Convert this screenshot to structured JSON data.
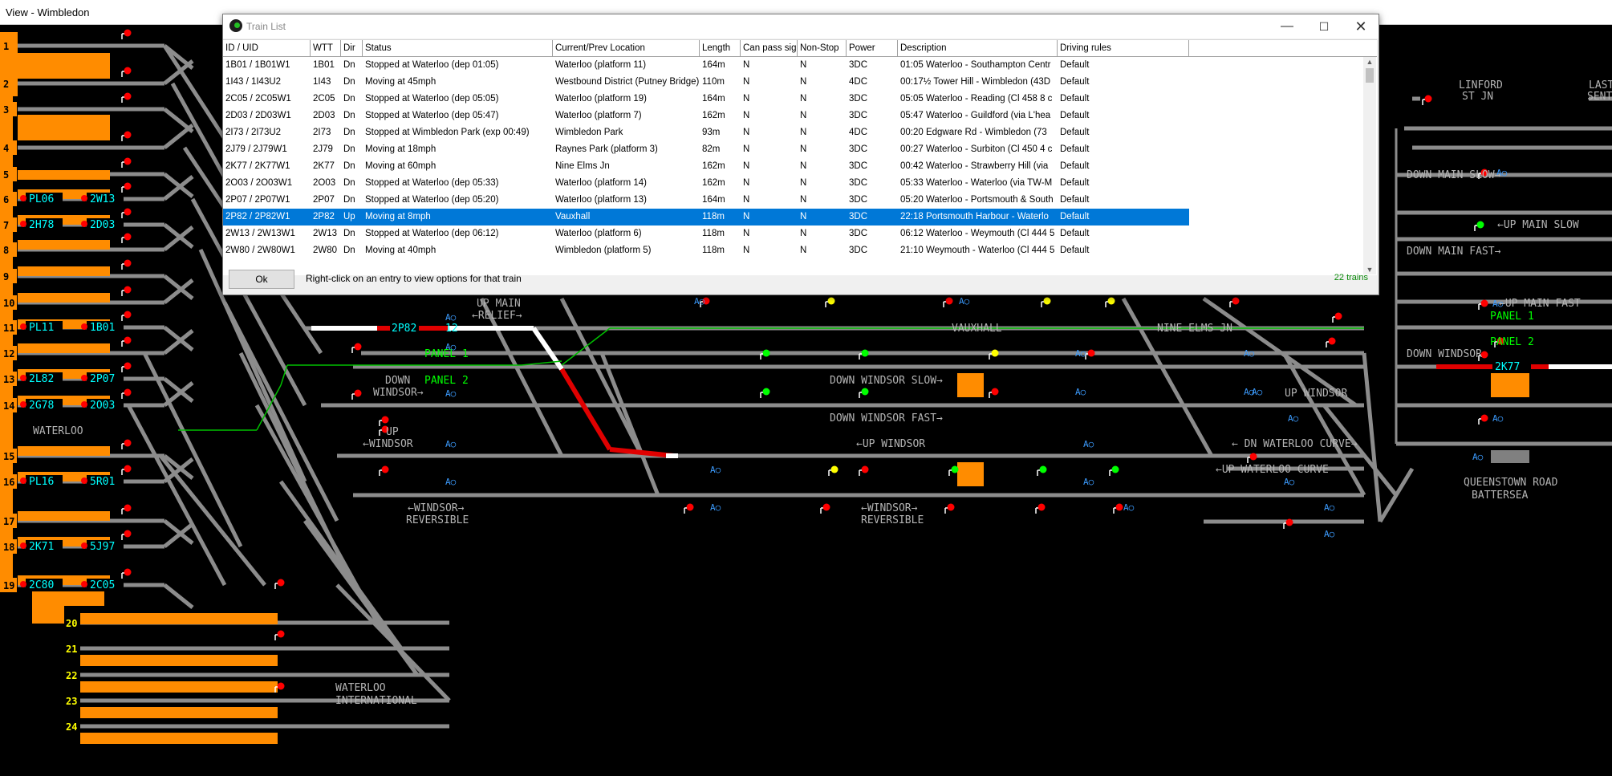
{
  "window": {
    "title": "View - Wimbledon"
  },
  "dialog": {
    "title": "Train List",
    "ok_label": "Ok",
    "hint": "Right-click on an entry to view options for that train",
    "count": "22 trains",
    "columns": [
      "ID / UID",
      "WTT",
      "Dir",
      "Status",
      "Current/Prev Location",
      "Length",
      "Can pass sig",
      "Non-Stop",
      "Power",
      "Description",
      "Driving rules"
    ],
    "selected_row": 9,
    "rows": [
      [
        "1B01 / 1B01W1",
        "1B01",
        "Dn",
        "Stopped at Waterloo (dep 01:05)",
        "Waterloo (platform 11)",
        "164m",
        "N",
        "N",
        "3DC",
        "01:05 Waterloo - Southampton Centr",
        "Default"
      ],
      [
        "1I43 / 1I43U2",
        "1I43",
        "Dn",
        "Moving at 45mph",
        "Westbound District (Putney Bridge)",
        "110m",
        "N",
        "N",
        "4DC",
        "00:17½ Tower Hill - Wimbledon (43D",
        "Default"
      ],
      [
        "2C05 / 2C05W1",
        "2C05",
        "Dn",
        "Stopped at Waterloo (dep 05:05)",
        "Waterloo (platform 19)",
        "164m",
        "N",
        "N",
        "3DC",
        "05:05 Waterloo - Reading (Cl 458 8 c",
        "Default"
      ],
      [
        "2D03 / 2D03W1",
        "2D03",
        "Dn",
        "Stopped at Waterloo (dep 05:47)",
        "Waterloo (platform 7)",
        "162m",
        "N",
        "N",
        "3DC",
        "05:47 Waterloo - Guildford (via L'hea",
        "Default"
      ],
      [
        "2I73 / 2I73U2",
        "2I73",
        "Dn",
        "Stopped at Wimbledon Park (exp 00:49)",
        "Wimbledon Park",
        "93m",
        "N",
        "N",
        "4DC",
        "00:20 Edgware Rd - Wimbledon (73",
        "Default"
      ],
      [
        "2J79 / 2J79W1",
        "2J79",
        "Dn",
        "Moving at 18mph",
        "Raynes Park (platform 3)",
        "82m",
        "N",
        "N",
        "3DC",
        "00:27 Waterloo - Surbiton (Cl 450 4 c",
        "Default"
      ],
      [
        "2K77 / 2K77W1",
        "2K77",
        "Dn",
        "Moving at 60mph",
        "Nine Elms Jn",
        "162m",
        "N",
        "N",
        "3DC",
        "00:42 Waterloo - Strawberry Hill (via",
        "Default"
      ],
      [
        "2O03 / 2O03W1",
        "2O03",
        "Dn",
        "Stopped at Waterloo (dep 05:33)",
        "Waterloo (platform 14)",
        "162m",
        "N",
        "N",
        "3DC",
        "05:33 Waterloo - Waterloo (via TW-M",
        "Default"
      ],
      [
        "2P07 / 2P07W1",
        "2P07",
        "Dn",
        "Stopped at Waterloo (dep 05:20)",
        "Waterloo (platform 13)",
        "164m",
        "N",
        "N",
        "3DC",
        "05:20 Waterloo - Portsmouth & South",
        "Default"
      ],
      [
        "2P82 / 2P82W1",
        "2P82",
        "Up",
        "Moving at 8mph",
        "Vauxhall",
        "118m",
        "N",
        "N",
        "3DC",
        "22:18 Portsmouth Harbour - Waterlo",
        "Default"
      ],
      [
        "2W13 / 2W13W1",
        "2W13",
        "Dn",
        "Stopped at Waterloo (dep 06:12)",
        "Waterloo (platform 6)",
        "118m",
        "N",
        "N",
        "3DC",
        "06:12 Waterloo - Weymouth (Cl 444 5",
        "Default"
      ],
      [
        "2W80 / 2W80W1",
        "2W80",
        "Dn",
        "Moving at 40mph",
        "Wimbledon (platform 5)",
        "118m",
        "N",
        "N",
        "3DC",
        "21:10 Weymouth - Waterloo (Cl 444 5",
        "Default"
      ]
    ]
  },
  "platforms": [
    "1",
    "2",
    "3",
    "4",
    "5",
    "6",
    "7",
    "8",
    "9",
    "10",
    "11",
    "12",
    "13",
    "14",
    "15",
    "16",
    "17",
    "18",
    "19",
    "20",
    "21",
    "22",
    "23",
    "24"
  ],
  "train_ids": {
    "p6a": "PL06",
    "p6b": "2W13",
    "p7a": "2H78",
    "p7b": "2D03",
    "p11a": "PL11",
    "p11b": "1B01",
    "p13a": "2L82",
    "p13b": "2P07",
    "p14a": "2G78",
    "p14b": "2O03",
    "p16a": "PL16",
    "p16b": "5R01",
    "p18a": "2K71",
    "p18b": "5J97",
    "p19a": "2C80",
    "p19b": "2C05",
    "moving": "2P82",
    "moving_b": "12",
    "right": "2K77"
  },
  "labels": {
    "waterloo": "WATERLOO",
    "up_main_relief_1": "UP MAIN",
    "up_main_relief_2": "←RELIEF→",
    "panel1": "PANEL 1",
    "panel2": "PANEL 2",
    "down_windsor_1": "DOWN",
    "down_windsor_2": "WINDSOR→",
    "up_windsor_l1": "UP",
    "up_windsor_l2": "←WINDSOR",
    "windsor_rev_1": "←WINDSOR→",
    "windsor_rev_2": "REVERSIBLE",
    "windsor_rev_3": "←WINDSOR→",
    "windsor_rev_4": "REVERSIBLE",
    "waterloo_intl_1": "WATERLOO",
    "waterloo_intl_2": "INTERNATIONAL",
    "vauxhall": "VAUXHALL",
    "nine_elms": "NINE ELMS JN",
    "down_windsor_slow": "DOWN WINDSOR SLOW→",
    "down_windsor_fast": "DOWN WINDSOR FAST→",
    "up_windsor_mid": "←UP WINDSOR",
    "up_windsor_right": "UP WINDSOR",
    "dn_waterloo_curve": "← DN WATERLOO CURVE→",
    "up_waterloo_curve": "←UP WATERLOO CURVE",
    "linford_1": "LINFORD",
    "linford_2": "ST JN",
    "last_1": "LAST",
    "last_2": "SENT",
    "down_main_slow": "DOWN MAIN SLOW→",
    "up_main_slow": "←UP MAIN SLOW",
    "down_main_fast": "DOWN MAIN FAST→",
    "up_main_fast": "←UP MAIN FAST",
    "panel1_r": "PANEL 1",
    "panel2_r": "PANEL 2",
    "down_windsor_r": "DOWN WINDSOR",
    "queenstown_1": "QUEENSTOWN ROAD",
    "queenstown_2": "BATTERSEA"
  },
  "colors": {
    "track": "#8c8c8c",
    "occupied": "#ff8c00",
    "platform_num": "#ffff00",
    "train_id": "#00ffff",
    "route_set": "#ffffff",
    "route_red": "#e00000",
    "label": "#b4b4b4",
    "panel": "#00ff00",
    "signal_red": "#ff0000",
    "signal_green": "#00ff00",
    "signal_yellow": "#ffff00",
    "selection": "#0078d7"
  }
}
